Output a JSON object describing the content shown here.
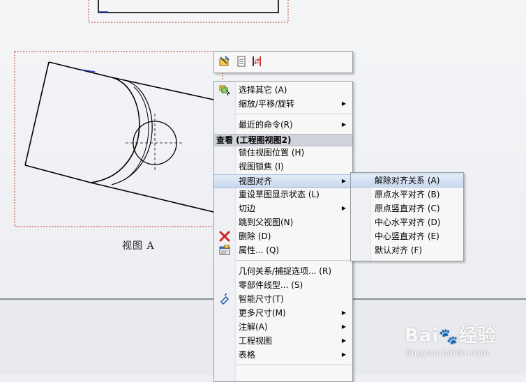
{
  "view_caption": "视图 A",
  "toolbar": {
    "buttons": [
      "smart-dimension-icon",
      "sheet-format-icon",
      "align-icon"
    ]
  },
  "context_menu": {
    "items_top": [
      {
        "label": "选择其它 (A)",
        "icon": "select-other-icon",
        "submenu": false
      },
      {
        "label": "缩放/平移/旋转",
        "submenu": true
      },
      {
        "label": "最近的命令(R)",
        "submenu": true
      }
    ],
    "section_header": "查看 (工程图视图2)",
    "items_view": [
      {
        "label": "锁住视图位置 (H)",
        "submenu": false
      },
      {
        "label": "视图锁焦 (I)",
        "submenu": false
      },
      {
        "label": "视图对齐",
        "submenu": true,
        "highlighted": true
      },
      {
        "label": "重设草图显示状态 (L)",
        "submenu": false
      },
      {
        "label": "切边",
        "submenu": true
      },
      {
        "label": "跳到父视图(N)",
        "submenu": false
      },
      {
        "label": "删除 (D)",
        "icon": "delete-icon",
        "submenu": false
      },
      {
        "label": "属性... (Q)",
        "icon": "properties-icon",
        "submenu": false
      }
    ],
    "items_bottom": [
      {
        "label": "几何关系/捕捉选项... (R)",
        "submenu": false
      },
      {
        "label": "零部件线型... (S)",
        "submenu": false
      },
      {
        "label": "智能尺寸(T)",
        "icon": "smart-dimension-icon",
        "submenu": false
      },
      {
        "label": "更多尺寸(M)",
        "submenu": true
      },
      {
        "label": "注解(A)",
        "submenu": true
      },
      {
        "label": "工程视图",
        "submenu": true
      },
      {
        "label": "表格",
        "submenu": true
      }
    ]
  },
  "submenu": {
    "items": [
      {
        "label": "解除对齐关系 (A)",
        "highlighted": true
      },
      {
        "label": "原点水平对齐 (B)"
      },
      {
        "label": "原点竖直对齐 (C)"
      },
      {
        "label": "中心水平对齐 (D)"
      },
      {
        "label": "中心竖直对齐 (E)"
      },
      {
        "label": "默认对齐 (F)"
      }
    ]
  },
  "watermark": {
    "brand": "Bai",
    "brand_cn": "经验",
    "url": "jingyan.baidu.com"
  }
}
